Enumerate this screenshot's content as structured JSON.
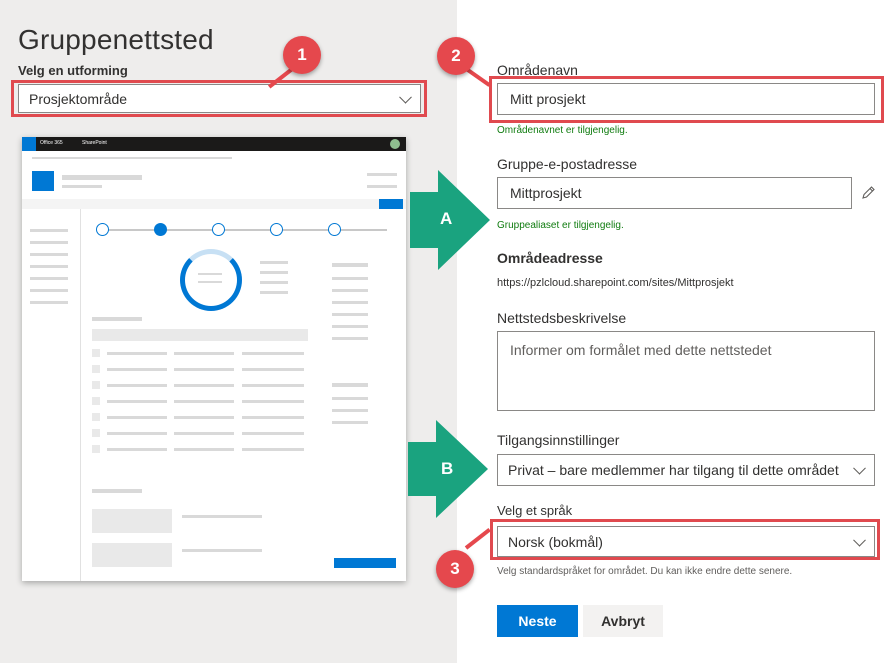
{
  "left": {
    "title": "Gruppenettsted",
    "design_label": "Velg en utforming",
    "design_value": "Prosjektområde",
    "preview": {
      "office_label": "Office 365",
      "sharepoint_label": "SharePoint"
    }
  },
  "form": {
    "site_name": {
      "label": "Områdenavn",
      "value": "Mitt prosjekt",
      "hint": "Områdenavnet er tilgjengelig."
    },
    "group_email": {
      "label": "Gruppe-e-postadresse",
      "value": "Mittprosjekt",
      "hint": "Gruppealiaset er tilgjengelig."
    },
    "site_address": {
      "label": "Områdeadresse",
      "value": "https://pzlcloud.sharepoint.com/sites/Mittprosjekt"
    },
    "description": {
      "label": "Nettstedsbeskrivelse",
      "placeholder": "Informer om formålet med dette nettstedet"
    },
    "privacy": {
      "label": "Tilgangsinnstillinger",
      "value": "Privat – bare medlemmer har tilgang til dette området"
    },
    "language": {
      "label": "Velg et språk",
      "value": "Norsk (bokmål)",
      "hint": "Velg standardspråket for området. Du kan ikke endre dette senere."
    },
    "next_button": "Neste",
    "cancel_button": "Avbryt"
  },
  "annotations": {
    "badges": [
      "1",
      "2",
      "3"
    ],
    "arrows": [
      "A",
      "B"
    ],
    "badge_color": "#e5484d",
    "arrow_color": "#1aa37f"
  },
  "icons": {
    "chevron": "chevron-down-icon",
    "edit": "pencil-icon",
    "waffle": "app-launcher-icon"
  },
  "colors": {
    "primary": "#0078d4",
    "success": "#107c10",
    "highlight": "#e04a4f",
    "left_bg": "#eeedec"
  }
}
